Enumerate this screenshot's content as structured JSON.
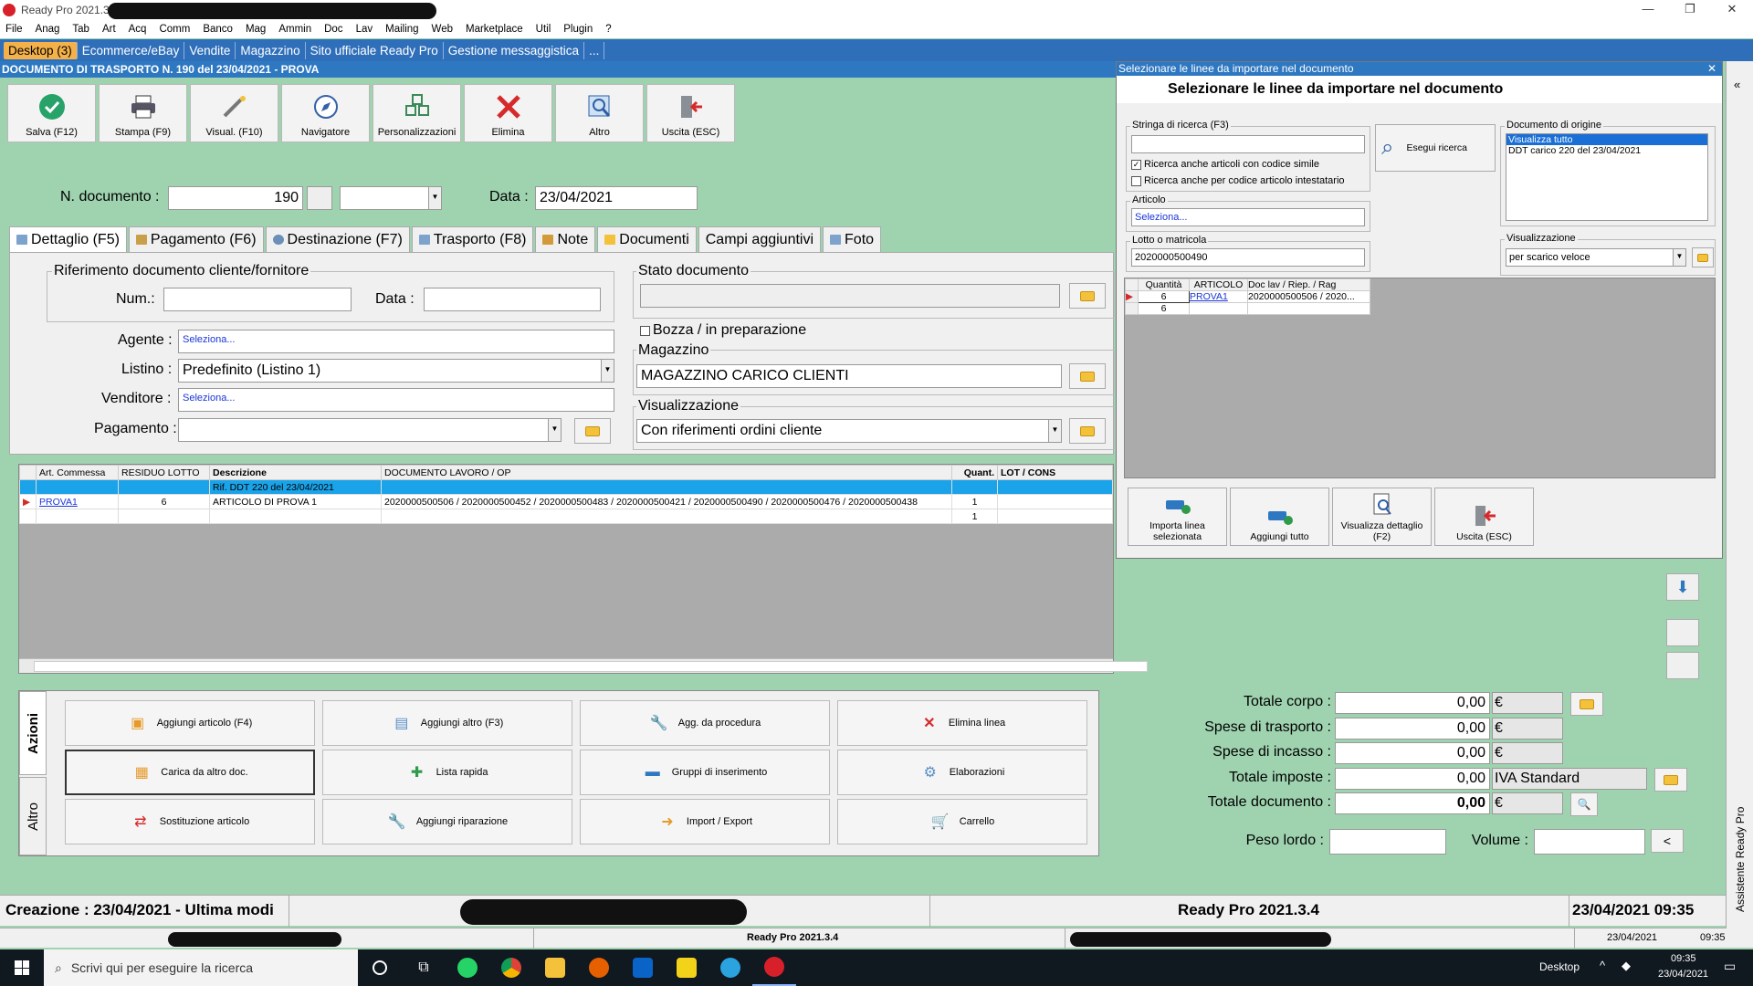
{
  "window": {
    "title": "Ready Pro 2021.3",
    "controls": [
      "—",
      "❐",
      "✕"
    ]
  },
  "menu": [
    "File",
    "Anag",
    "Tab",
    "Art",
    "Acq",
    "Comm",
    "Banco",
    "Mag",
    "Ammin",
    "Doc",
    "Lav",
    "Mailing",
    "Web",
    "Marketplace",
    "Util",
    "Plugin",
    "?"
  ],
  "tabs": [
    {
      "label": "Desktop (3)",
      "active": true
    },
    {
      "label": "Ecommerce/eBay"
    },
    {
      "label": "Vendite"
    },
    {
      "label": "Magazzino"
    },
    {
      "label": "Sito ufficiale Ready Pro"
    },
    {
      "label": "Gestione messaggistica"
    },
    {
      "label": "..."
    }
  ],
  "doc_header": "DOCUMENTO DI TRASPORTO N. 190 del 23/04/2021 - PROVA",
  "toolbar": [
    {
      "label": "Salva (F12)",
      "icon": "check-icon"
    },
    {
      "label": "Stampa (F9)",
      "icon": "printer-icon"
    },
    {
      "label": "Visual. (F10)",
      "icon": "view-icon"
    },
    {
      "label": "Navigatore",
      "icon": "compass-icon"
    },
    {
      "label": "Personalizzazioni",
      "icon": "grid-icon"
    },
    {
      "label": "Elimina",
      "icon": "delete-icon"
    },
    {
      "label": "Altro",
      "icon": "more-icon"
    },
    {
      "label": "Uscita (ESC)",
      "icon": "exit-icon"
    }
  ],
  "form": {
    "ndoc_label": "N. documento :",
    "ndoc_value": "190",
    "data_label": "Data :",
    "data_value": "23/04/2021"
  },
  "doc_tabs": [
    {
      "label": "Dettaglio (F5)",
      "active": true
    },
    {
      "label": "Pagamento (F6)"
    },
    {
      "label": "Destinazione (F7)"
    },
    {
      "label": "Trasporto (F8)"
    },
    {
      "label": "Note"
    },
    {
      "label": "Documenti"
    },
    {
      "label": "Campi aggiuntivi"
    },
    {
      "label": "Foto"
    }
  ],
  "detail": {
    "rif_title": "Riferimento documento cliente/fornitore",
    "num_label": "Num.:",
    "num_value": "",
    "data_label": "Data :",
    "data_value": "",
    "agente_label": "Agente :",
    "agente_value": "Seleziona...",
    "listino_label": "Listino :",
    "listino_value": "Predefinito (Listino 1)",
    "venditore_label": "Venditore :",
    "venditore_value": "Seleziona...",
    "pagamento_label": "Pagamento :",
    "pagamento_value": "",
    "stato_title": "Stato documento",
    "stato_value": "",
    "bozza_label": "Bozza / in preparazione",
    "bozza_checked": false,
    "magazzino_title": "Magazzino",
    "magazzino_value": "MAGAZZINO CARICO CLIENTI",
    "visual_title": "Visualizzazione",
    "visual_value": "Con riferimenti ordini cliente"
  },
  "grid": {
    "columns": [
      "Art. Commessa",
      "RESIDUO LOTTO",
      "Descrizione",
      "DOCUMENTO LAVORO / OP",
      "Quant.",
      "LOT / CONS"
    ],
    "rows": [
      {
        "art": "",
        "residuo": "",
        "descr": "Rif. DDT 220 del 23/04/2021",
        "doc": "",
        "qty": "",
        "lot": "",
        "selected": true
      },
      {
        "art": "PROVA1",
        "residuo": "6",
        "descr": "ARTICOLO DI PROVA 1",
        "doc": "2020000500506 / 2020000500452 / 2020000500483 / 2020000500421 / 2020000500490 / 2020000500476 / 2020000500438",
        "qty": "1",
        "lot": ""
      },
      {
        "art": "",
        "residuo": "",
        "descr": "",
        "doc": "",
        "qty": "1",
        "lot": ""
      }
    ]
  },
  "actions": {
    "vtabs": [
      "Azioni",
      "Altro"
    ],
    "buttons": [
      {
        "label": "Aggiungi articolo (F4)",
        "icon": "add-article-icon"
      },
      {
        "label": "Aggiungi altro (F3)",
        "icon": "add-other-icon"
      },
      {
        "label": "Agg. da procedura",
        "icon": "wrench-icon"
      },
      {
        "label": "Elimina linea",
        "icon": "delete-line-icon"
      },
      {
        "label": "Carica da altro doc.",
        "icon": "load-doc-icon",
        "highlight": true
      },
      {
        "label": "Lista rapida",
        "icon": "quick-list-icon"
      },
      {
        "label": "Gruppi di inserimento",
        "icon": "groups-icon"
      },
      {
        "label": "Elaborazioni",
        "icon": "process-icon"
      },
      {
        "label": "Sostituzione articolo",
        "icon": "replace-icon"
      },
      {
        "label": "Aggiungi riparazione",
        "icon": "repair-icon"
      },
      {
        "label": "Import / Export",
        "icon": "import-export-icon"
      },
      {
        "label": "Carrello",
        "icon": "cart-icon"
      }
    ]
  },
  "totals": {
    "corpo_label": "Totale corpo :",
    "corpo_value": "0,00",
    "trasporto_label": "Spese di trasporto :",
    "trasporto_value": "0,00",
    "incasso_label": "Spese di incasso :",
    "incasso_value": "0,00",
    "imposte_label": "Totale imposte :",
    "imposte_value": "0,00",
    "iva_label": "IVA Standard",
    "documento_label": "Totale documento :",
    "documento_value": "0,00",
    "currency": "€",
    "peso_label": "Peso lordo :",
    "peso_value": "",
    "volume_label": "Volume :",
    "volume_value": "",
    "lt_btn": "<"
  },
  "status": {
    "creation": "Creazione : 23/04/2021 - Ultima modi",
    "center": "Ready Pro 2021.3.4",
    "date_time": "23/04/2021 09:35",
    "bar2_center": "Ready Pro 2021.3.4",
    "bar2_date": "23/04/2021",
    "bar2_time": "09:35"
  },
  "side_assistant": "Assistente Ready Pro",
  "dialog": {
    "title": "Selezionare le linee da importare nel documento",
    "heading": "Selezionare le linee da importare nel documento",
    "search_label": "Stringa di ricerca (F3)",
    "search_value": "",
    "chk_simile": "Ricerca anche articoli con codice simile",
    "chk_simile_checked": true,
    "chk_intestatario": "Ricerca anche per codice articolo intestatario",
    "chk_intestatario_checked": false,
    "search_btn": "Esegui ricerca",
    "origin_label": "Documento di origine",
    "origin_items": [
      {
        "label": "Visualizza tutto",
        "selected": true
      },
      {
        "label": "DDT carico 220 del 23/04/2021"
      }
    ],
    "articolo_label": "Articolo",
    "articolo_value": "Seleziona...",
    "lotto_label": "Lotto o matricola",
    "lotto_value": "2020000500490",
    "visual_label": "Visualizzazione",
    "visual_value": "per scarico veloce",
    "grid_columns": [
      "Quantità",
      "ARTICOLO",
      "Doc lav / Riep. / Rag"
    ],
    "grid_rows": [
      {
        "qty": "6",
        "art": "PROVA1",
        "doc": "2020000500506 / 2020..."
      },
      {
        "qty": "6",
        "art": "",
        "doc": ""
      }
    ],
    "buttons": [
      {
        "label": "Importa linea selezionata",
        "icon": "import-line-icon"
      },
      {
        "label": "Aggiungi tutto",
        "icon": "add-all-icon"
      },
      {
        "label": "Visualizza dettaglio (F2)",
        "icon": "detail-icon"
      },
      {
        "label": "Uscita (ESC)",
        "icon": "exit-icon"
      }
    ]
  },
  "taskbar": {
    "search_placeholder": "Scrivi qui per eseguire la ricerca",
    "desktop_label": "Desktop",
    "time": "09:35",
    "date": "23/04/2021"
  },
  "colors": {
    "tab_strip": "#2f6fba",
    "active_tab": "#f4b14a",
    "background": "#9fd3b0",
    "selected_row": "#1aa3e8"
  }
}
